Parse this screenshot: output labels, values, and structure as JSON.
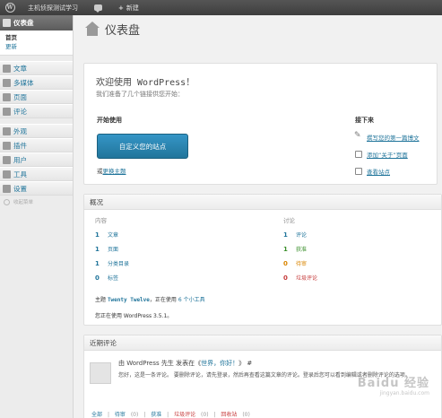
{
  "adminbar": {
    "site_name": "主机侦探测试学习",
    "new_label": "新建"
  },
  "sidebar": {
    "dashboard": "仪表盘",
    "submenu": [
      "首页",
      "更新"
    ],
    "items": [
      "文章",
      "多媒体",
      "页面",
      "评论",
      "外观",
      "插件",
      "用户",
      "工具",
      "设置"
    ],
    "collapse": "收起菜单"
  },
  "page": {
    "title": "仪表盘"
  },
  "welcome": {
    "title": "欢迎使用 WordPress！",
    "about": "我们准备了几个链接供您开始：",
    "get_started": "开始使用",
    "customize_button": "自定义您的站点",
    "or_text": "或",
    "change_theme": "更换主题",
    "next_steps": "接下来",
    "next_items": [
      "撰写您的第一篇博文",
      "添加“关于”页面",
      "查看站点"
    ]
  },
  "glance": {
    "title": "概况",
    "content_label": "内容",
    "discussion_label": "讨论",
    "content": [
      {
        "num": "1",
        "label": "文章"
      },
      {
        "num": "1",
        "label": "页面"
      },
      {
        "num": "1",
        "label": "分类目录"
      },
      {
        "num": "0",
        "label": "标签"
      }
    ],
    "discussion": [
      {
        "num": "1",
        "label": "评论"
      },
      {
        "num": "1",
        "label": "获准"
      },
      {
        "num": "0",
        "label": "待审"
      },
      {
        "num": "0",
        "label": "垃圾评论"
      }
    ],
    "theme_prefix": "主题",
    "theme_name": "Twenty Twelve",
    "theme_mid": "，正在使用",
    "widgets": "6 个小工具",
    "version_text": "您正在使用 WordPress 3.5.1。"
  },
  "comments": {
    "title": "近期评论",
    "author_line_prefix": "由 WordPress 先生 发表在《",
    "post_link": "世界，你好！",
    "author_line_suffix": "》 #",
    "body": "您好，这是一条评论。 要删除评论，请先登录，然后再查看这篇文章的评论。登录后您可以看到编辑或者删除评论的选项。",
    "links": {
      "all": "全部",
      "pending": "待审",
      "pending_count": "(0)",
      "approved": "获准",
      "spam": "垃圾评论",
      "spam_count": "(0)",
      "trash": "回收站",
      "trash_count": "(0)"
    }
  },
  "watermark": {
    "main": "Baidu 经验",
    "sub": "jingyan.baidu.com"
  }
}
